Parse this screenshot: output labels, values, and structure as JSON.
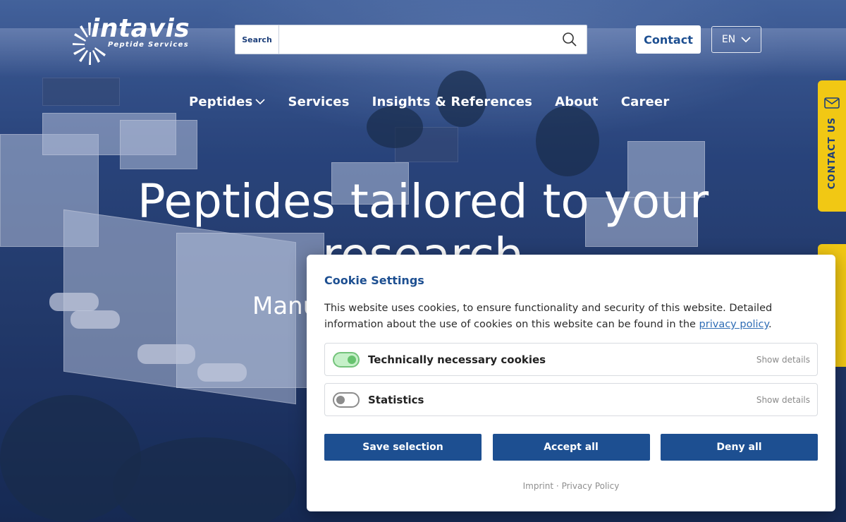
{
  "header": {
    "logo_text": "intavis",
    "logo_subtitle": "Peptide Services",
    "search_label": "Search",
    "search_value": "",
    "search_icon": "search-icon",
    "contact_label": "Contact",
    "language": "EN"
  },
  "nav": {
    "items": [
      {
        "label": "Peptides",
        "has_dropdown": true
      },
      {
        "label": "Services"
      },
      {
        "label": "Insights & References"
      },
      {
        "label": "About"
      },
      {
        "label": "Career"
      }
    ]
  },
  "hero": {
    "title_line1": "Peptides tailored to your",
    "title_line2": "research",
    "subtitle": "Manu"
  },
  "side_tabs": {
    "contact_label": "CONTACT US",
    "contact_icon": "mail-icon"
  },
  "cookie_dialog": {
    "title": "Cookie Settings",
    "text_before_link": "This website uses cookies, to ensure functionality and security of this website. Detailed information about the use of cookies on this website can be found in the ",
    "link_text": "privacy policy",
    "text_after_link": ".",
    "options": [
      {
        "label": "Technically necessary cookies",
        "enabled": true,
        "details_label": "Show details"
      },
      {
        "label": "Statistics",
        "enabled": false,
        "details_label": "Show details"
      }
    ],
    "buttons": {
      "save": "Save selection",
      "accept": "Accept all",
      "deny": "Deny all"
    },
    "footer": {
      "imprint": "Imprint",
      "separator": "·",
      "privacy": "Privacy Policy"
    }
  },
  "colors": {
    "brand_blue": "#1d4f91",
    "accent_yellow": "#f1c814",
    "toggle_green": "#67c36f"
  }
}
